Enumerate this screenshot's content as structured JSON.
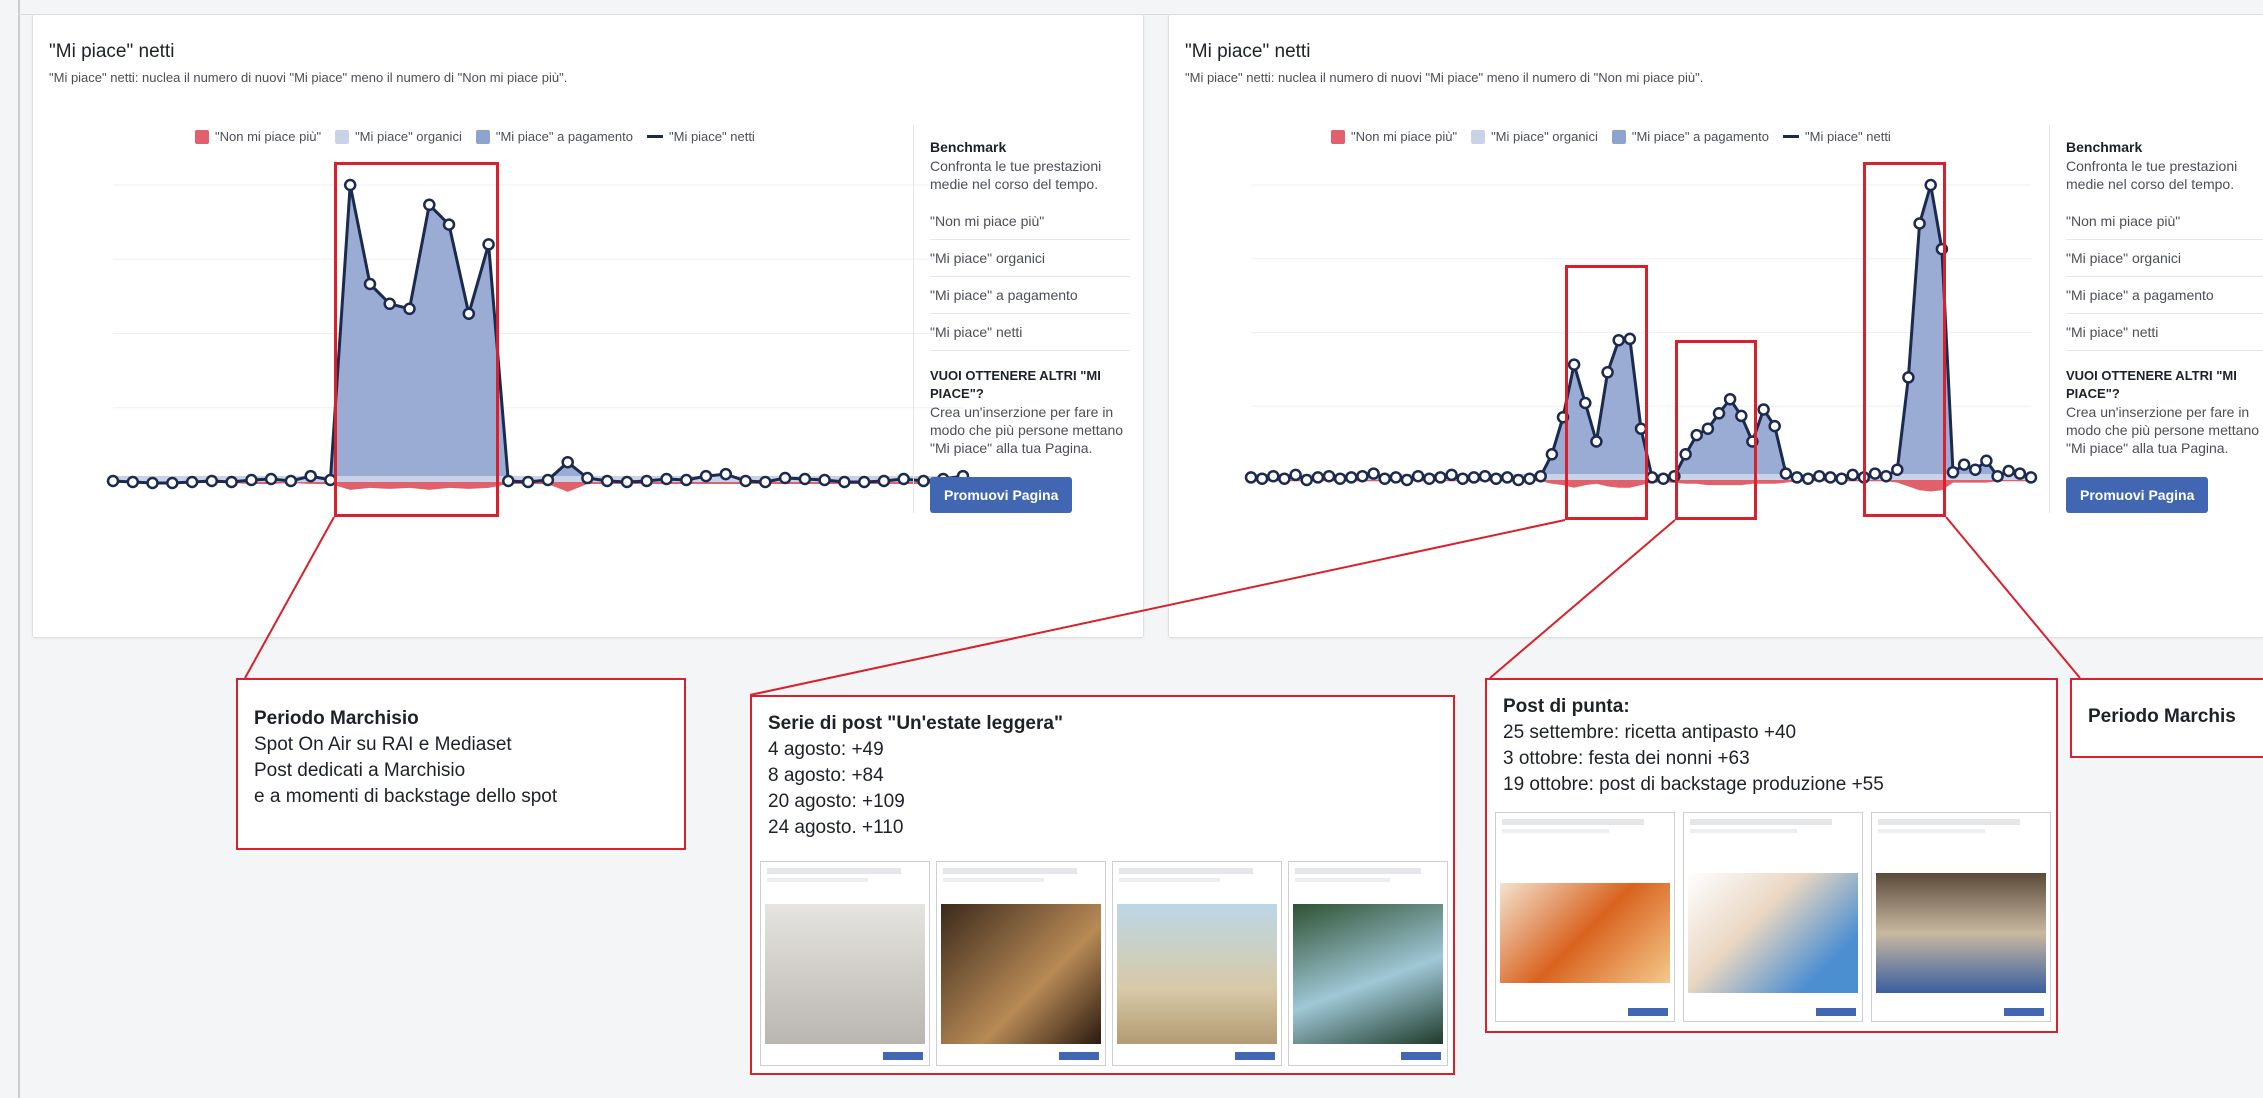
{
  "colors": {
    "unlikes": "#e0606b",
    "organic": "#c8d2e8",
    "paid": "#8fa3cf",
    "net": "#1b2a4e",
    "highlight": "#d8212a",
    "button": "#4267b2"
  },
  "left_card": {
    "title": "\"Mi piace\" netti",
    "subtitle": "\"Mi piace\" netti: nuclea il numero di nuovi \"Mi piace\" meno il numero di \"Non mi piace più\".",
    "legend": [
      "\"Non mi piace più\"",
      "\"Mi piace\" organici",
      "\"Mi piace\" a pagamento",
      "\"Mi piace\" netti"
    ],
    "side": {
      "heading": "Benchmark",
      "desc": "Confronta le tue prestazioni medie nel corso del tempo.",
      "rows": [
        "\"Non mi piace più\"",
        "\"Mi piace\" organici",
        "\"Mi piace\" a pagamento",
        "\"Mi piace\" netti"
      ],
      "cta_title": "VUOI OTTENERE ALTRI \"MI PIACE\"?",
      "cta_desc": "Crea un'inserzione per fare in modo che più persone mettano \"Mi piace\" alla tua Pagina.",
      "button": "Promuovi Pagina"
    }
  },
  "right_card": {
    "title": "\"Mi piace\" netti",
    "subtitle": "\"Mi piace\" netti: nuclea il numero di nuovi \"Mi piace\" meno il numero di \"Non mi piace più\".",
    "legend": [
      "\"Non mi piace più\"",
      "\"Mi piace\" organici",
      "\"Mi piace\" a pagamento",
      "\"Mi piace\" netti"
    ],
    "side": {
      "heading": "Benchmark",
      "desc": "Confronta le tue prestazioni medie nel corso del tempo.",
      "rows": [
        "\"Non mi piace più\"",
        "\"Mi piace\" organici",
        "\"Mi piace\" a pagamento",
        "\"Mi piace\" netti"
      ],
      "cta_title": "VUOI OTTENERE ALTRI \"MI PIACE\"?",
      "cta_desc": "Crea un'inserzione per fare in modo che più persone mettano \"Mi piace\" alla tua Pagina.",
      "button": "Promuovi Pagina"
    }
  },
  "chart_data": [
    {
      "type": "area",
      "series": [
        {
          "name": "\"Mi piace\" netti",
          "values": [
            1,
            0,
            -1,
            -1,
            0,
            1,
            0,
            2,
            3,
            1,
            6,
            2,
            300,
            200,
            180,
            175,
            280,
            260,
            170,
            240,
            1,
            0,
            2,
            20,
            4,
            1,
            0,
            1,
            3,
            2,
            6,
            8,
            1,
            0,
            4,
            3,
            2,
            0,
            0,
            1,
            3,
            1,
            3,
            6
          ]
        },
        {
          "name": "\"Non mi piace più\"",
          "values": [
            -1,
            -1,
            -1,
            -1,
            -1,
            -1,
            -1,
            -2,
            -2,
            -1,
            -2,
            -2,
            -8,
            -6,
            -7,
            -6,
            -8,
            -6,
            -7,
            -6,
            -2,
            -2,
            -2,
            -10,
            -2,
            -2,
            -2,
            -2,
            -2,
            -2,
            -2,
            -2,
            -2,
            -2,
            -2,
            -2,
            -2,
            -2,
            -2,
            -2,
            -2,
            -2,
            -2,
            -2
          ]
        }
      ]
    },
    {
      "type": "area",
      "series": [
        {
          "name": "\"Mi piace\" netti",
          "values": [
            2,
            1,
            3,
            1,
            4,
            0,
            2,
            3,
            1,
            2,
            3,
            5,
            1,
            2,
            0,
            3,
            1,
            2,
            4,
            1,
            2,
            3,
            1,
            2,
            0,
            1,
            3,
            20,
            49,
            90,
            60,
            30,
            84,
            109,
            110,
            40,
            2,
            1,
            3,
            20,
            35,
            40,
            52,
            63,
            50,
            30,
            55,
            42,
            5,
            2,
            1,
            3,
            2,
            1,
            4,
            2,
            5,
            3,
            8,
            80,
            200,
            230,
            180,
            6,
            12,
            8,
            15,
            3,
            7,
            5,
            2
          ]
        },
        {
          "name": "\"Non mi piace più\"",
          "values": [
            -1,
            -1,
            -1,
            -1,
            -1,
            -1,
            -1,
            -1,
            -1,
            -1,
            -1,
            -1,
            -1,
            -1,
            -1,
            -1,
            -1,
            -1,
            -1,
            -1,
            -1,
            -1,
            -1,
            -1,
            -1,
            -1,
            -1,
            -3,
            -4,
            -6,
            -4,
            -3,
            -5,
            -6,
            -6,
            -4,
            -2,
            -2,
            -2,
            -3,
            -3,
            -4,
            -4,
            -4,
            -4,
            -3,
            -3,
            -3,
            -2,
            -1,
            -1,
            -1,
            -1,
            -1,
            -1,
            -1,
            -1,
            -1,
            -2,
            -5,
            -8,
            -9,
            -8,
            -2,
            -2,
            -2,
            -2,
            -1,
            -1,
            -1,
            -1
          ]
        }
      ]
    }
  ],
  "callouts": {
    "marchisio_left": {
      "title": "Periodo Marchisio",
      "lines": [
        "Spot On Air su RAI e Mediaset",
        "Post dedicati a Marchisio",
        "e a momenti di backstage dello spot"
      ]
    },
    "serie": {
      "title": "Serie di post \"Un'estate leggera\"",
      "lines": [
        "4 agosto: +49",
        "8 agosto: +84",
        "20 agosto: +109",
        "24 agosto. +110"
      ]
    },
    "punta": {
      "title": "Post di punta:",
      "lines": [
        "25 settembre: ricetta antipasto +40",
        "3 ottobre: festa dei nonni +63",
        "19 ottobre: post di backstage produzione +55"
      ]
    },
    "marchisio_right": {
      "title": "Periodo Marchis"
    }
  }
}
